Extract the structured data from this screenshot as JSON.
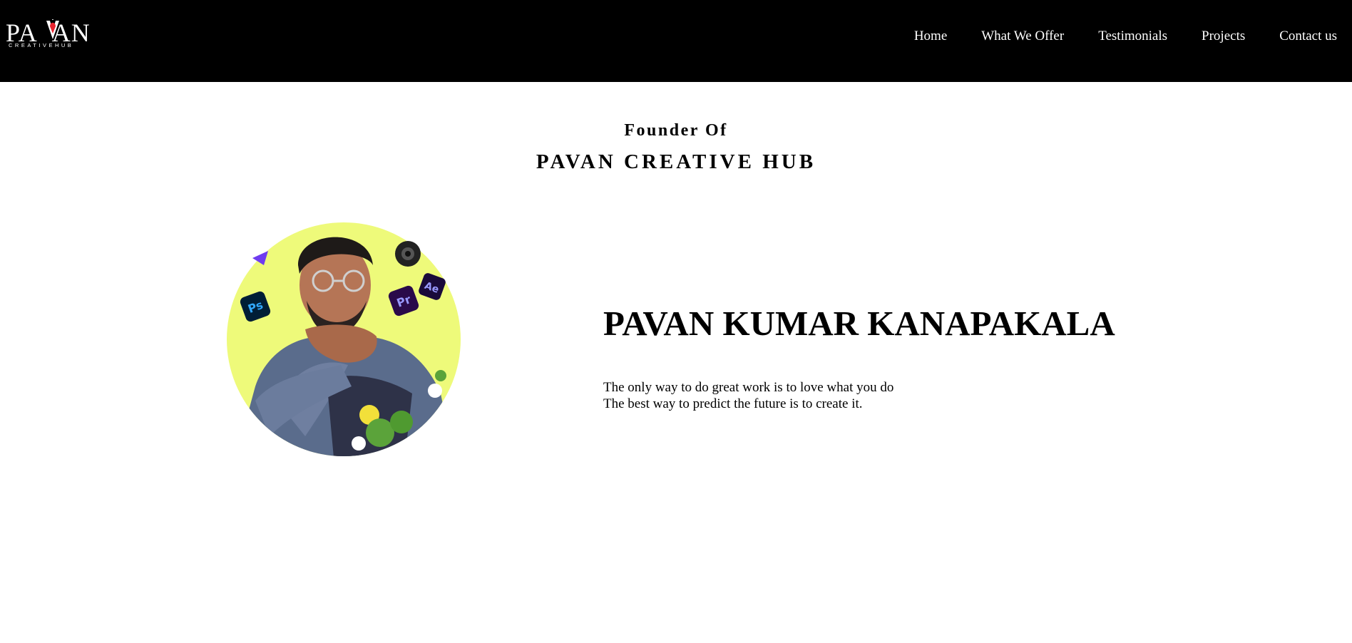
{
  "theme": {
    "nav_bg": "#000000",
    "nav_text": "#ffffff",
    "portrait_bg": "#eefa7a",
    "logo_accent": "#e8242f"
  },
  "header": {
    "logo": {
      "word": "PAVAN",
      "tagline": "CREATIVEHUB",
      "icon": "logo-mark-icon"
    },
    "nav": [
      {
        "label": "Home"
      },
      {
        "label": "What We Offer"
      },
      {
        "label": "Testimonials"
      },
      {
        "label": "Projects"
      },
      {
        "label": "Contact us"
      }
    ]
  },
  "hero": {
    "kicker": "Founder Of",
    "company": "PAVAN CREATIVE HUB",
    "name": "PAVAN KUMAR KANAPAKALA",
    "quotes": [
      "The only way to do great work is to love what you do",
      "The best way to predict the future is to create it."
    ],
    "portrait_icons": [
      {
        "icon": "photoshop-icon",
        "text": "Ps"
      },
      {
        "icon": "premiere-icon",
        "text": "Pr"
      },
      {
        "icon": "after-effects-icon",
        "text": "Ae"
      },
      {
        "icon": "camera-lens-icon"
      }
    ]
  }
}
